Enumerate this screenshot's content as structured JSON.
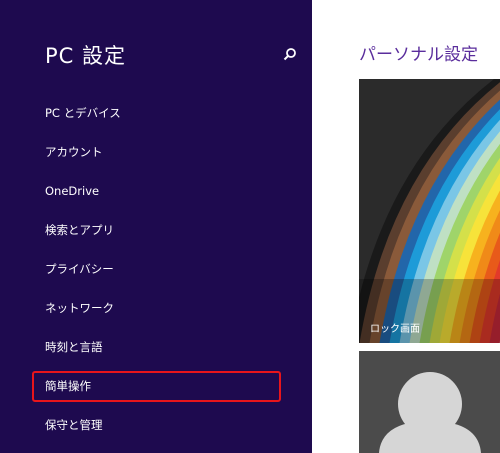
{
  "sidebar": {
    "title": "PC 設定",
    "items": [
      {
        "label": "PC とデバイス"
      },
      {
        "label": "アカウント"
      },
      {
        "label": "OneDrive"
      },
      {
        "label": "検索とアプリ"
      },
      {
        "label": "プライバシー"
      },
      {
        "label": "ネットワーク"
      },
      {
        "label": "時刻と言語"
      },
      {
        "label": "簡単操作"
      },
      {
        "label": "保守と管理"
      }
    ],
    "highlighted_item": "簡単操作"
  },
  "main": {
    "title": "パーソナル設定",
    "lock_screen_tile": {
      "label": "ロック画面"
    },
    "account_picture_tile": {
      "icon": "user-silhouette-icon"
    }
  },
  "colors": {
    "sidebar_background": "#1e0a4f",
    "accent_title": "#5a2d9c",
    "highlight_border": "#e8151b"
  }
}
